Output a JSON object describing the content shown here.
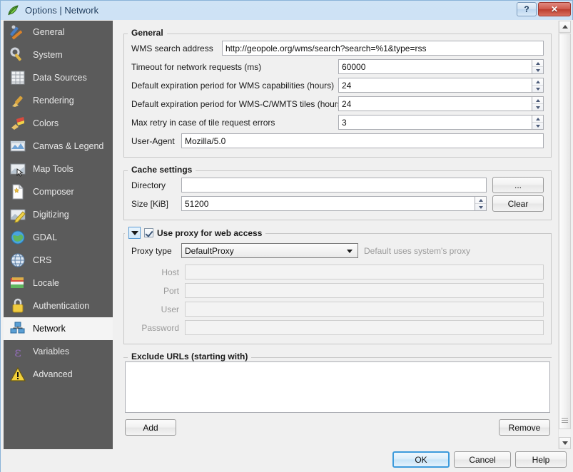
{
  "window": {
    "title": "Options | Network",
    "app_icon": "qgis-leaf-icon",
    "help_button": "?",
    "close_button": "✕"
  },
  "sidebar": {
    "items": [
      {
        "label": "General",
        "icon": "hammer-wrench-icon",
        "selected": false
      },
      {
        "label": "System",
        "icon": "wrench-gear-icon",
        "selected": false
      },
      {
        "label": "Data Sources",
        "icon": "table-grid-icon",
        "selected": false
      },
      {
        "label": "Rendering",
        "icon": "paintbrush-icon",
        "selected": false
      },
      {
        "label": "Colors",
        "icon": "color-brush-icon",
        "selected": false
      },
      {
        "label": "Canvas & Legend",
        "icon": "map-canvas-icon",
        "selected": false
      },
      {
        "label": "Map Tools",
        "icon": "map-cursor-icon",
        "selected": false
      },
      {
        "label": "Composer",
        "icon": "page-compose-icon",
        "selected": false
      },
      {
        "label": "Digitizing",
        "icon": "pencil-map-icon",
        "selected": false
      },
      {
        "label": "GDAL",
        "icon": "globe-green-icon",
        "selected": false
      },
      {
        "label": "CRS",
        "icon": "globe-wire-icon",
        "selected": false
      },
      {
        "label": "Locale",
        "icon": "flags-icon",
        "selected": false
      },
      {
        "label": "Authentication",
        "icon": "lock-icon",
        "selected": false
      },
      {
        "label": "Network",
        "icon": "network-icon",
        "selected": true
      },
      {
        "label": "Variables",
        "icon": "epsilon-icon",
        "selected": false
      },
      {
        "label": "Advanced",
        "icon": "warning-icon",
        "selected": false
      }
    ]
  },
  "general_group": {
    "title": "General",
    "wms_search_address": {
      "label": "WMS search address",
      "value": "http://geopole.org/wms/search?search=%1&type=rss"
    },
    "timeout": {
      "label": "Timeout for network requests (ms)",
      "value": "60000"
    },
    "wms_capabilities_expiry": {
      "label": "Default expiration period for WMS capabilities (hours)",
      "value": "24"
    },
    "wmsc_tiles_expiry": {
      "label": "Default expiration period for WMS-C/WMTS tiles (hours)",
      "value": "24"
    },
    "max_retry": {
      "label": "Max retry in case of tile request errors",
      "value": "3"
    },
    "user_agent": {
      "label": "User-Agent",
      "value": "Mozilla/5.0"
    }
  },
  "cache_group": {
    "title": "Cache settings",
    "directory": {
      "label": "Directory",
      "value": "",
      "browse_label": "..."
    },
    "size": {
      "label": "Size [KiB]",
      "value": "51200",
      "clear_label": "Clear"
    }
  },
  "proxy_group": {
    "checkbox_label": "Use proxy for web access",
    "checked": true,
    "collapsed": false,
    "proxy_type": {
      "label": "Proxy type",
      "value": "DefaultProxy",
      "hint": "Default uses system's proxy"
    },
    "host": {
      "label": "Host",
      "value": "",
      "enabled": false
    },
    "port": {
      "label": "Port",
      "value": "",
      "enabled": false
    },
    "user": {
      "label": "User",
      "value": "",
      "enabled": false
    },
    "password": {
      "label": "Password",
      "value": "",
      "enabled": false
    }
  },
  "exclude_group": {
    "title": "Exclude URLs (starting with)",
    "entries": [],
    "add_label": "Add",
    "remove_label": "Remove"
  },
  "dialog_buttons": {
    "ok": "OK",
    "cancel": "Cancel",
    "help": "Help"
  },
  "colors": {
    "titlebar_start": "#cfe3f5",
    "titlebar_end": "#aed0ee",
    "sidebar_bg": "#5b5b5b",
    "content_bg": "#f0f0f0",
    "accent_default_button": "#3c9bdc",
    "close_button": "#cf5a4c"
  }
}
